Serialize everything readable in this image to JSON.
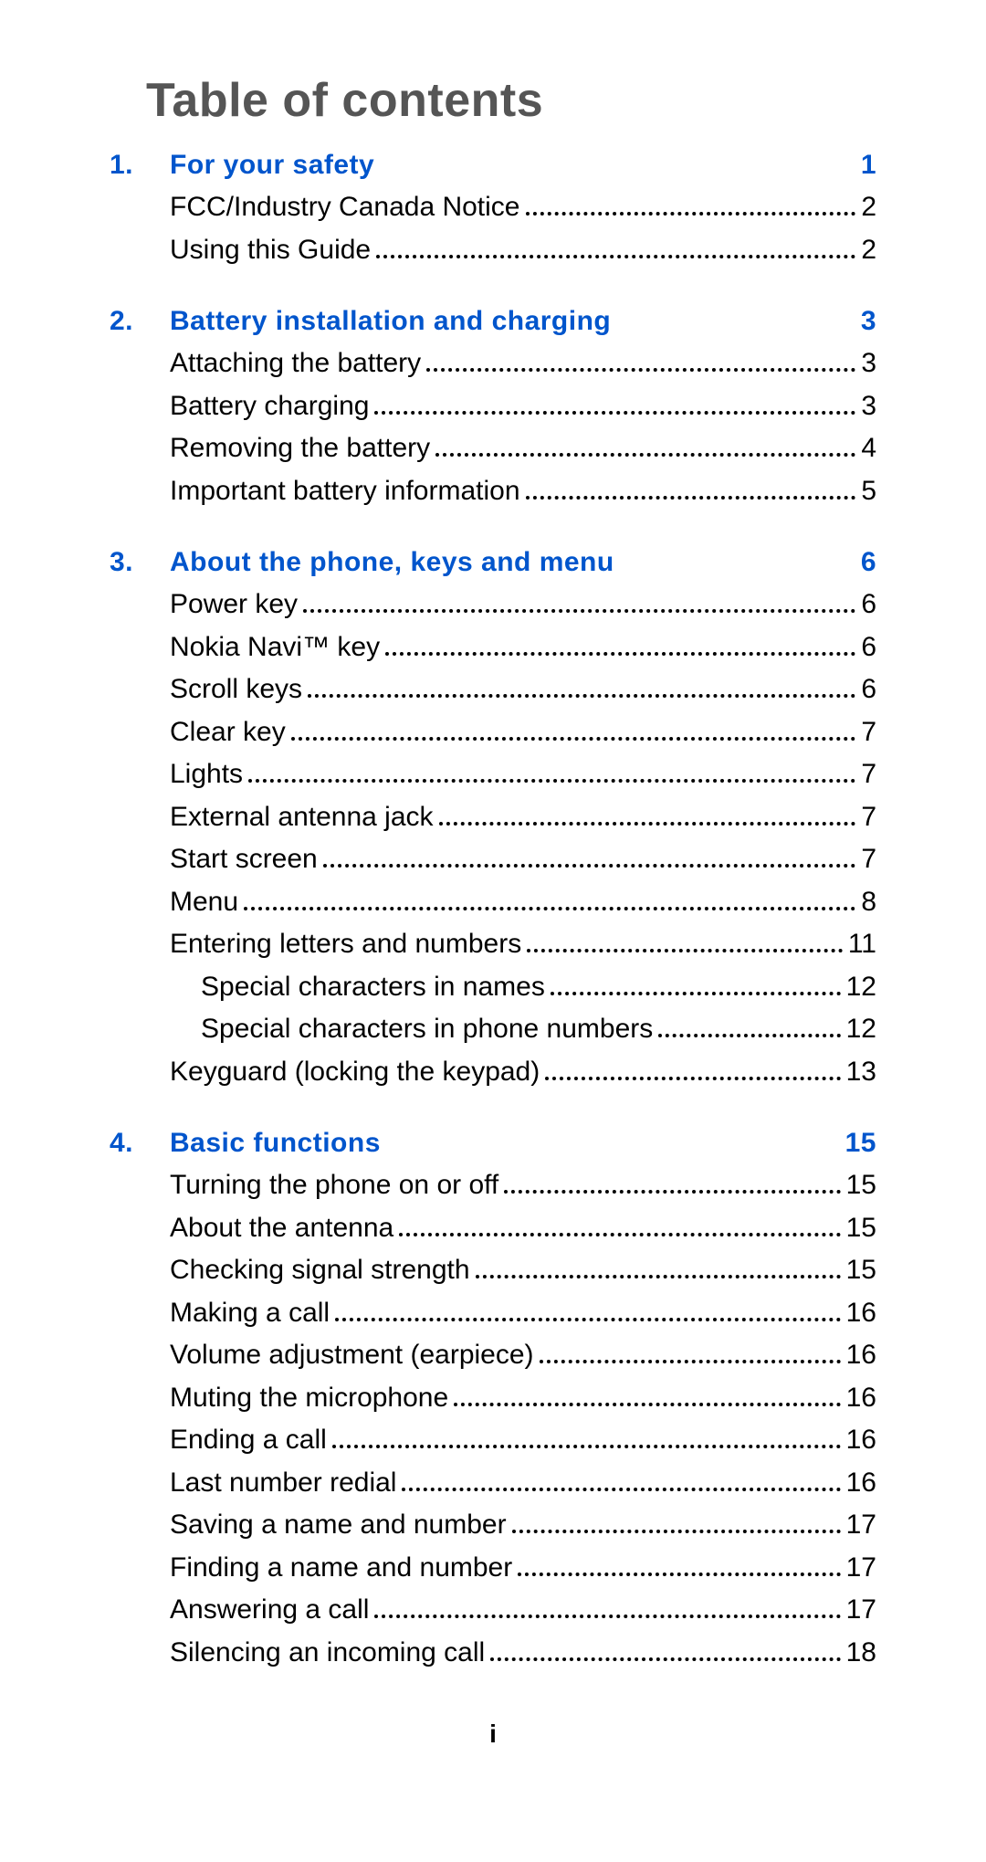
{
  "title": "Table of contents",
  "page_number": "i",
  "sections": [
    {
      "num": "1.",
      "label": "For your safety",
      "page": "1",
      "entries": [
        {
          "label": "FCC/Industry Canada Notice",
          "page": "2",
          "indent": false
        },
        {
          "label": "Using this Guide",
          "page": "2",
          "indent": false
        }
      ]
    },
    {
      "num": "2.",
      "label": "Battery installation and charging",
      "page": "3",
      "entries": [
        {
          "label": "Attaching the battery",
          "page": "3",
          "indent": false
        },
        {
          "label": "Battery charging",
          "page": "3",
          "indent": false
        },
        {
          "label": "Removing the battery",
          "page": "4",
          "indent": false
        },
        {
          "label": "Important battery information",
          "page": "5",
          "indent": false
        }
      ]
    },
    {
      "num": "3.",
      "label": "About the phone, keys and menu",
      "page": "6",
      "entries": [
        {
          "label": "Power key",
          "page": "6",
          "indent": false
        },
        {
          "label": "Nokia Navi™ key",
          "page": "6",
          "indent": false
        },
        {
          "label": "Scroll keys",
          "page": "6",
          "indent": false
        },
        {
          "label": "Clear key",
          "page": "7",
          "indent": false
        },
        {
          "label": "Lights",
          "page": "7",
          "indent": false
        },
        {
          "label": "External antenna jack",
          "page": "7",
          "indent": false
        },
        {
          "label": "Start screen",
          "page": "7",
          "indent": false
        },
        {
          "label": "Menu",
          "page": "8",
          "indent": false
        },
        {
          "label": "Entering letters and numbers",
          "page": "11",
          "indent": false
        },
        {
          "label": "Special characters in names",
          "page": "12",
          "indent": true
        },
        {
          "label": "Special characters in phone numbers",
          "page": "12",
          "indent": true
        },
        {
          "label": "Keyguard (locking the keypad)",
          "page": "13",
          "indent": false
        }
      ]
    },
    {
      "num": "4.",
      "label": "Basic functions",
      "page": "15",
      "entries": [
        {
          "label": "Turning the phone on or off",
          "page": "15",
          "indent": false
        },
        {
          "label": "About the antenna",
          "page": "15",
          "indent": false
        },
        {
          "label": "Checking signal strength",
          "page": "15",
          "indent": false
        },
        {
          "label": "Making a call",
          "page": "16",
          "indent": false
        },
        {
          "label": "Volume adjustment (earpiece)",
          "page": "16",
          "indent": false
        },
        {
          "label": "Muting the microphone",
          "page": "16",
          "indent": false
        },
        {
          "label": "Ending a call",
          "page": "16",
          "indent": false
        },
        {
          "label": "Last number redial",
          "page": "16",
          "indent": false
        },
        {
          "label": "Saving a name and number",
          "page": "17",
          "indent": false
        },
        {
          "label": "Finding a name and number",
          "page": "17",
          "indent": false
        },
        {
          "label": "Answering a call",
          "page": "17",
          "indent": false
        },
        {
          "label": "Silencing an incoming call",
          "page": "18",
          "indent": false
        }
      ]
    }
  ]
}
